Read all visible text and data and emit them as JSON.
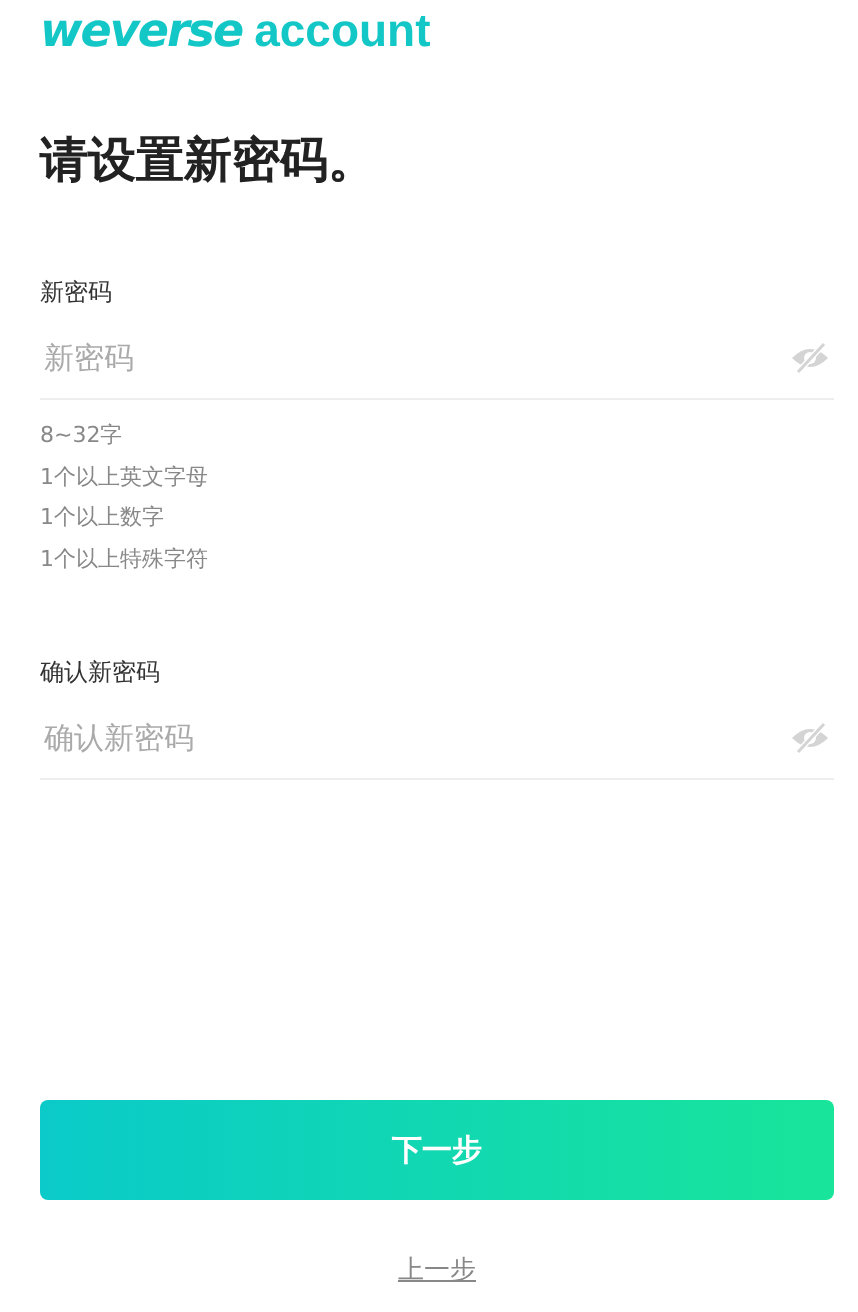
{
  "logo": {
    "brand": "weverse",
    "product": "account"
  },
  "heading": "请设置新密码。",
  "fields": [
    {
      "label": "新密码",
      "placeholder": "新密码",
      "rules": [
        "8~32字",
        "1个以上英文字母",
        "1个以上数字",
        "1个以上特殊字符"
      ]
    },
    {
      "label": "确认新密码",
      "placeholder": "确认新密码"
    }
  ],
  "next_button": "下一步",
  "back_link": "上一步"
}
